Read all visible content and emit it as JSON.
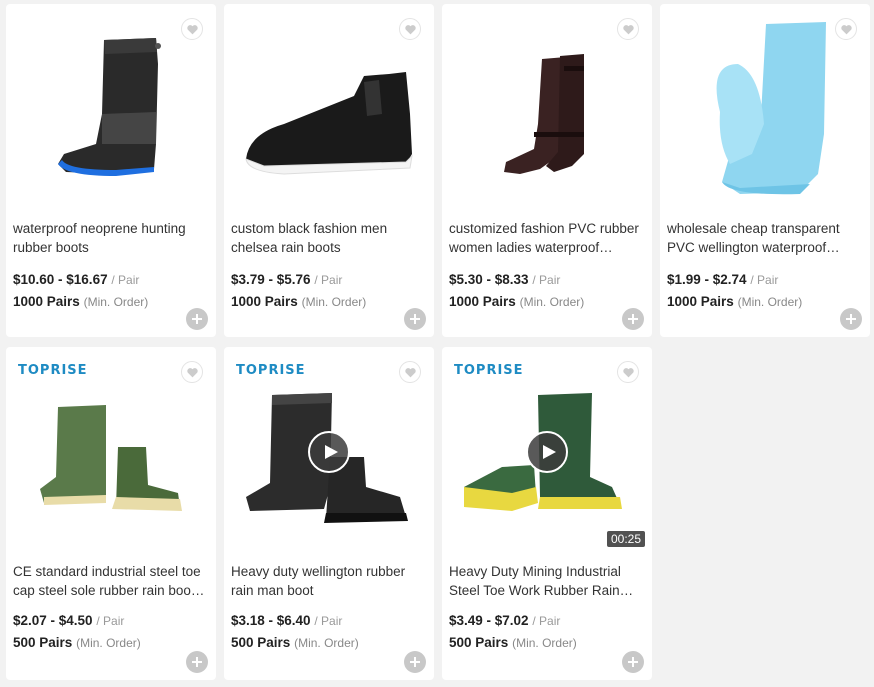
{
  "colors": {
    "brand": "#1e8bc3",
    "add_button": "#c8c8c8"
  },
  "products": [
    {
      "title": "waterproof neoprene hunting rubber boots",
      "price": "$10.60 - $16.67",
      "unit": "/ Pair",
      "moq": "1000 Pairs",
      "moq_note": "(Min. Order)",
      "image": "neoprene-hunting-boot"
    },
    {
      "title": "custom black fashion men chelsea rain boots",
      "price": "$3.79 - $5.76",
      "unit": "/ Pair",
      "moq": "1000 Pairs",
      "moq_note": "(Min. Order)",
      "image": "black-chelsea-boot"
    },
    {
      "title": "customized fashion PVC rubber women ladies waterproof…",
      "price": "$5.30 - $8.33",
      "unit": "/ Pair",
      "moq": "1000 Pairs",
      "moq_note": "(Min. Order)",
      "image": "brown-riding-boot"
    },
    {
      "title": "wholesale cheap transparent PVC wellington waterproof…",
      "price": "$1.99 - $2.74",
      "unit": "/ Pair",
      "moq": "1000 Pairs",
      "moq_note": "(Min. Order)",
      "image": "transparent-blue-boot"
    },
    {
      "title": "CE standard industrial steel toe cap steel sole rubber rain boo…",
      "price": "$2.07 - $4.50",
      "unit": "/ Pair",
      "moq": "500 Pairs",
      "moq_note": "(Min. Order)",
      "brand": "TOPRISE",
      "image": "green-industrial-boots"
    },
    {
      "title": "Heavy duty wellington rubber rain man boot",
      "price": "$3.18 - $6.40",
      "unit": "/ Pair",
      "moq": "500 Pairs",
      "moq_note": "(Min. Order)",
      "brand": "TOPRISE",
      "has_video": true,
      "image": "black-wellington-boots"
    },
    {
      "title": "Heavy Duty Mining Industrial Steel Toe Work Rubber Rain…",
      "price": "$3.49 - $7.02",
      "unit": "/ Pair",
      "moq": "500 Pairs",
      "moq_note": "(Min. Order)",
      "brand": "TOPRISE",
      "has_video": true,
      "video_duration": "00:25",
      "image": "green-yellow-mining-boots"
    }
  ]
}
